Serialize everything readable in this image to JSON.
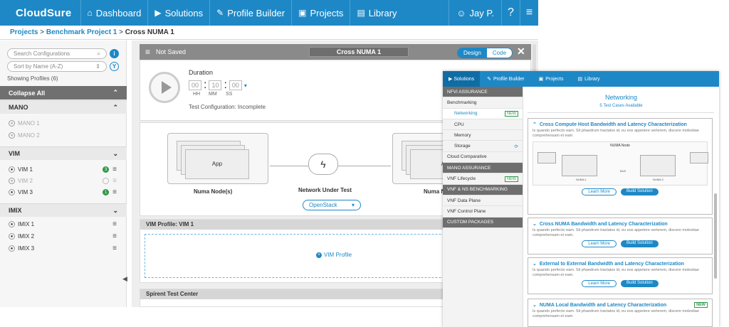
{
  "topnav": {
    "brand": "CloudSure",
    "items": [
      "Dashboard",
      "Solutions",
      "Profile Builder",
      "Projects",
      "Library"
    ],
    "user": "Jay P."
  },
  "breadcrumb": {
    "projects": "Projects",
    "sep": ">",
    "project": "Benchmark Project 1",
    "current": "Cross NUMA 1"
  },
  "sidebar": {
    "search_placeholder": "Search Configurations",
    "sort_value": "Sort by Name (A-Z)",
    "showing": "Showing Profiles (6)",
    "collapse": "Collapse All",
    "mano": {
      "title": "MANO",
      "items": [
        "MANO 1",
        "MANO 2"
      ]
    },
    "vim": {
      "title": "VIM",
      "items": [
        {
          "label": "VIM 1",
          "badge": "3"
        },
        {
          "label": "VIM 2",
          "badge": ""
        },
        {
          "label": "VIM 3",
          "badge": "1"
        }
      ]
    },
    "imix": {
      "title": "IMIX",
      "items": [
        "IMIX 1",
        "IMIX 2",
        "IMIX 3"
      ]
    }
  },
  "canvas": {
    "status": "Not Saved",
    "title": "Cross NUMA 1",
    "toggle": [
      "Design",
      "Code"
    ],
    "close": "✕",
    "duration": {
      "label": "Duration",
      "h": "00",
      "m": "10",
      "s": "00",
      "units": [
        "HH",
        "MM",
        "SS"
      ]
    },
    "config": "Test Configuration: Incomplete",
    "left_node": {
      "card": "App",
      "label": "Numa Node(s)"
    },
    "network": "Network Under Test",
    "dropdown": "OpenStack",
    "right_node": {
      "card": "A",
      "label": "Numa N"
    },
    "vim_profile_header": "VIM Profile: VIM 1",
    "add_vim": "VIM Profile",
    "spirent": "Spirent Test Center"
  },
  "overlay": {
    "nav": [
      "Solutions",
      "Profile Builder",
      "Projects",
      "Library"
    ],
    "side": [
      {
        "label": "NFVI ASSURANCE",
        "type": "group"
      },
      {
        "label": "Benchmarking",
        "type": "item"
      },
      {
        "label": "Networking",
        "type": "sub-active",
        "badge": "NEW"
      },
      {
        "label": "CPU",
        "type": "sub"
      },
      {
        "label": "Memory",
        "type": "sub"
      },
      {
        "label": "Storage",
        "type": "sub"
      },
      {
        "label": "Cloud Comparative",
        "type": "item"
      },
      {
        "label": "MANO ASSURANCE",
        "type": "group"
      },
      {
        "label": "VNF Lifecycle",
        "type": "item",
        "badge": "NEW"
      },
      {
        "label": "VNF & NS BENCHMARKING",
        "type": "group"
      },
      {
        "label": "VNF Data Plane",
        "type": "item"
      },
      {
        "label": "VNF Control Plane",
        "type": "item"
      },
      {
        "label": "CUSTOM PACKAGES",
        "type": "group"
      }
    ],
    "title": "Networking",
    "subtitle": "5 Test Cases Available",
    "desc": "Is quando perfecto eam. Sit phaedrum tractatos id, eu eos appetere verterem, discere molestiae comprehensam et eam.",
    "learn": "Learn More",
    "build": "Build Solution",
    "cases": [
      "Cross Compute Host Bandwidth and Latency Characterization",
      "Cross NUMA Bandwidth and Latency Characterization",
      "External to External Bandwidth and Latency Characterization",
      "NUMA Local Bandwidth and Latency Characterization"
    ],
    "new_badge": "NEW",
    "mini": {
      "title": "NUMA Node",
      "left": "NUMA 1",
      "right": "NUMA 2",
      "mid": "BUS"
    }
  }
}
